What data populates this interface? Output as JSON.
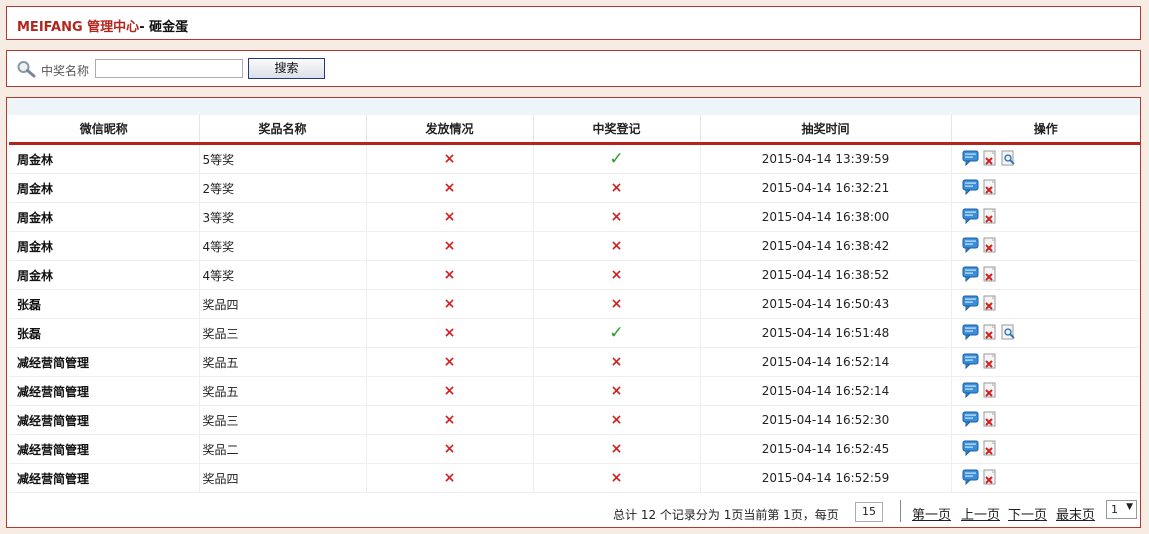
{
  "header": {
    "brand": "MEIFANG 管理中心",
    "page": "- 砸金蛋"
  },
  "search": {
    "label": "中奖名称",
    "value": "",
    "placeholder": "",
    "button": "搜索"
  },
  "table": {
    "columns": [
      "微信昵称",
      "奖品名称",
      "发放情况",
      "中奖登记",
      "抽奖时间",
      "操作"
    ],
    "rows": [
      {
        "nickname": "周金林",
        "prize": "5等奖",
        "issued": "×",
        "registered": "✓",
        "time": "2015-04-14 13:39:59",
        "ops": [
          "message-icon",
          "delete-icon",
          "view-icon"
        ]
      },
      {
        "nickname": "周金林",
        "prize": "2等奖",
        "issued": "×",
        "registered": "×",
        "time": "2015-04-14 16:32:21",
        "ops": [
          "message-icon",
          "delete-icon"
        ]
      },
      {
        "nickname": "周金林",
        "prize": "3等奖",
        "issued": "×",
        "registered": "×",
        "time": "2015-04-14 16:38:00",
        "ops": [
          "message-icon",
          "delete-icon"
        ]
      },
      {
        "nickname": "周金林",
        "prize": "4等奖",
        "issued": "×",
        "registered": "×",
        "time": "2015-04-14 16:38:42",
        "ops": [
          "message-icon",
          "delete-icon"
        ]
      },
      {
        "nickname": "周金林",
        "prize": "4等奖",
        "issued": "×",
        "registered": "×",
        "time": "2015-04-14 16:38:52",
        "ops": [
          "message-icon",
          "delete-icon"
        ]
      },
      {
        "nickname": "张磊",
        "prize": "奖品四",
        "issued": "×",
        "registered": "×",
        "time": "2015-04-14 16:50:43",
        "ops": [
          "message-icon",
          "delete-icon"
        ]
      },
      {
        "nickname": "张磊",
        "prize": "奖品三",
        "issued": "×",
        "registered": "✓",
        "time": "2015-04-14 16:51:48",
        "ops": [
          "message-icon",
          "delete-icon",
          "view-icon"
        ]
      },
      {
        "nickname": "减经营简管理",
        "prize": "奖品五",
        "issued": "×",
        "registered": "×",
        "time": "2015-04-14 16:52:14",
        "ops": [
          "message-icon",
          "delete-icon"
        ]
      },
      {
        "nickname": "减经营简管理",
        "prize": "奖品五",
        "issued": "×",
        "registered": "×",
        "time": "2015-04-14 16:52:14",
        "ops": [
          "message-icon",
          "delete-icon"
        ]
      },
      {
        "nickname": "减经营简管理",
        "prize": "奖品三",
        "issued": "×",
        "registered": "×",
        "time": "2015-04-14 16:52:30",
        "ops": [
          "message-icon",
          "delete-icon"
        ]
      },
      {
        "nickname": "减经营简管理",
        "prize": "奖品二",
        "issued": "×",
        "registered": "×",
        "time": "2015-04-14 16:52:45",
        "ops": [
          "message-icon",
          "delete-icon"
        ]
      },
      {
        "nickname": "减经营简管理",
        "prize": "奖品四",
        "issued": "×",
        "registered": "×",
        "time": "2015-04-14 16:52:59",
        "ops": [
          "message-icon",
          "delete-icon"
        ]
      }
    ]
  },
  "pager": {
    "info": "总计  12 个记录分为  1页当前第  1页，每页",
    "per_page": "15",
    "first": "第一页",
    "prev": "上一页",
    "next": "下一页",
    "last": "最末页",
    "page_select": "1"
  },
  "colors": {
    "accent": "#b3261e",
    "cross": "#d42020",
    "check": "#2b9a2b",
    "panel_bg": "#f6ece4"
  }
}
